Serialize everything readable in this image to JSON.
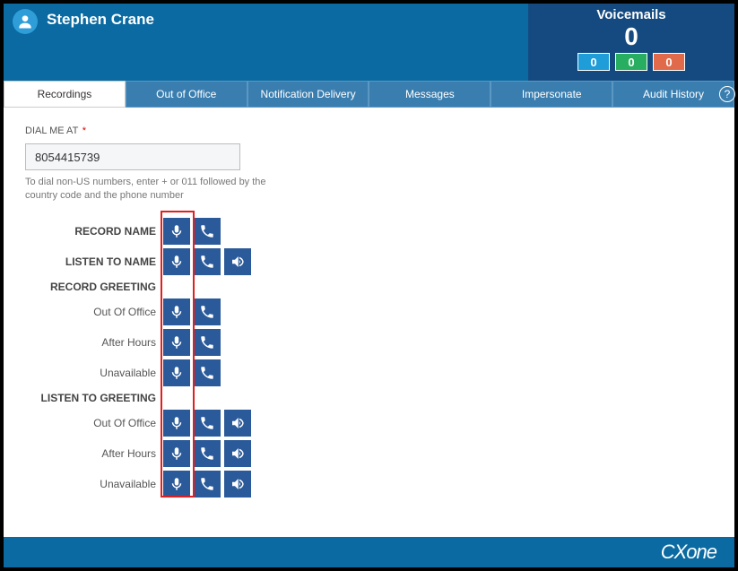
{
  "header": {
    "userName": "Stephen Crane",
    "voicemailsTitle": "Voicemails",
    "voicemailsCount": "0",
    "badges": {
      "blue": "0",
      "green": "0",
      "red": "0"
    }
  },
  "tabs": [
    {
      "label": "Recordings",
      "active": true
    },
    {
      "label": "Out of Office"
    },
    {
      "label": "Notification Delivery"
    },
    {
      "label": "Messages"
    },
    {
      "label": "Impersonate"
    },
    {
      "label": "Audit History"
    }
  ],
  "form": {
    "dialLabel": "DIAL ME AT",
    "dialValue": "8054415739",
    "dialHint": "To dial non-US numbers, enter + or 011 followed by the country code and the phone number"
  },
  "rows": {
    "recordName": "RECORD NAME",
    "listenToName": "LISTEN TO NAME",
    "recordGreeting": "RECORD GREETING",
    "outOfOffice": "Out Of Office",
    "afterHours": "After Hours",
    "unavailable": "Unavailable",
    "listenToGreeting": "LISTEN TO GREETING"
  },
  "footer": {
    "brandA": "CX",
    "brandB": "one"
  }
}
